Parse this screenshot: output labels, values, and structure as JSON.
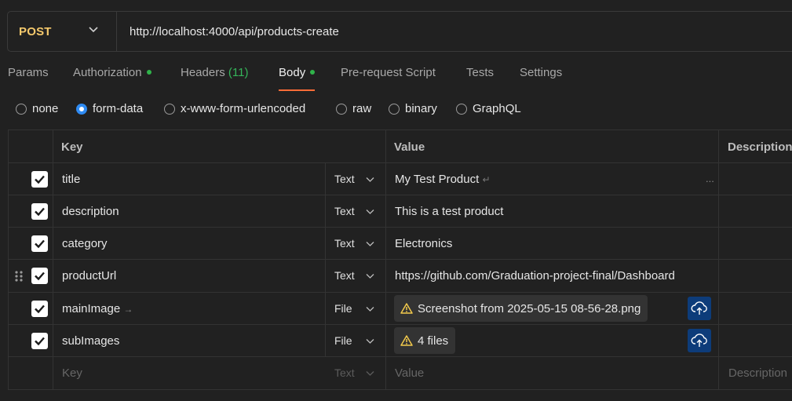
{
  "request": {
    "method": "POST",
    "url": "http://localhost:4000/api/products-create"
  },
  "tabs": [
    {
      "label": "Params"
    },
    {
      "label": "Authorization",
      "dot": true
    },
    {
      "label": "Headers",
      "count": "(11)"
    },
    {
      "label": "Body",
      "dot": true,
      "active": true
    },
    {
      "label": "Pre-request Script"
    },
    {
      "label": "Tests"
    },
    {
      "label": "Settings"
    }
  ],
  "body_types": [
    {
      "label": "none"
    },
    {
      "label": "form-data",
      "selected": true
    },
    {
      "label": "x-www-form-urlencoded"
    },
    {
      "label": "raw"
    },
    {
      "label": "binary"
    },
    {
      "label": "GraphQL"
    }
  ],
  "table": {
    "headers": {
      "key": "Key",
      "value": "Value",
      "description": "Description"
    },
    "rows": [
      {
        "checked": true,
        "key": "title",
        "type": "Text",
        "value": "My Test Product",
        "value_suffix": "↵",
        "more": "..."
      },
      {
        "checked": true,
        "key": "description",
        "type": "Text",
        "value": "This is a test product"
      },
      {
        "checked": true,
        "key": "category",
        "type": "Text",
        "value": "Electronics"
      },
      {
        "checked": true,
        "key": "productUrl",
        "type": "Text",
        "value": "https://github.com/Graduation-project-final/Dashboard"
      },
      {
        "checked": true,
        "key": "mainImage",
        "key_suffix": "→",
        "type": "File",
        "file": "Screenshot from 2025-05-15 08-56-28.png"
      },
      {
        "checked": true,
        "key": "subImages",
        "type": "File",
        "file": "4 files"
      }
    ],
    "new_row": {
      "key_placeholder": "Key",
      "type_placeholder": "Text",
      "value_placeholder": "Value",
      "description_placeholder": "Description"
    }
  },
  "colors": {
    "method": "#f5c96c",
    "active_tab_underline": "#ff6c37",
    "dot": "#30b34a",
    "radio": "#2f8bf2",
    "upload": "#0d3c7a"
  }
}
